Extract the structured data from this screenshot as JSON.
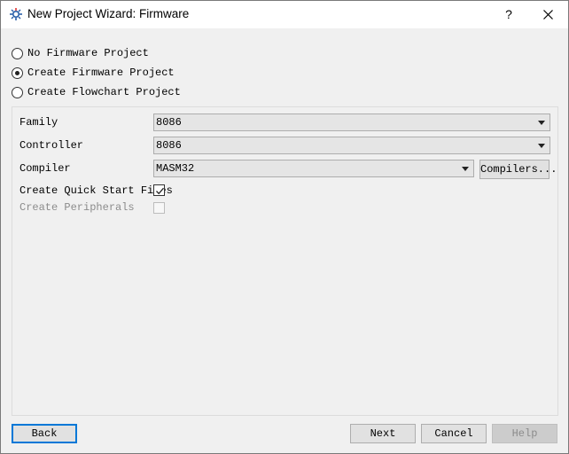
{
  "window": {
    "title": "New Project Wizard: Firmware",
    "help_label": "?"
  },
  "options": [
    {
      "label": "No Firmware Project",
      "checked": false
    },
    {
      "label": "Create Firmware Project",
      "checked": true
    },
    {
      "label": "Create Flowchart Project",
      "checked": false
    }
  ],
  "fields": {
    "family": {
      "label": "Family",
      "value": "8086"
    },
    "controller": {
      "label": "Controller",
      "value": "8086"
    },
    "compiler": {
      "label": "Compiler",
      "value": "MASM32",
      "button_label": "Compilers..."
    },
    "quick_start": {
      "label": "Create Quick Start Files",
      "checked": true
    },
    "peripherals": {
      "label": "Create Peripherals",
      "checked": false,
      "enabled": false
    }
  },
  "buttons": {
    "back": "Back",
    "next": "Next",
    "cancel": "Cancel",
    "help": "Help"
  },
  "colors": {
    "focus_accent": "#0078d7",
    "close_icon": "#000000"
  }
}
